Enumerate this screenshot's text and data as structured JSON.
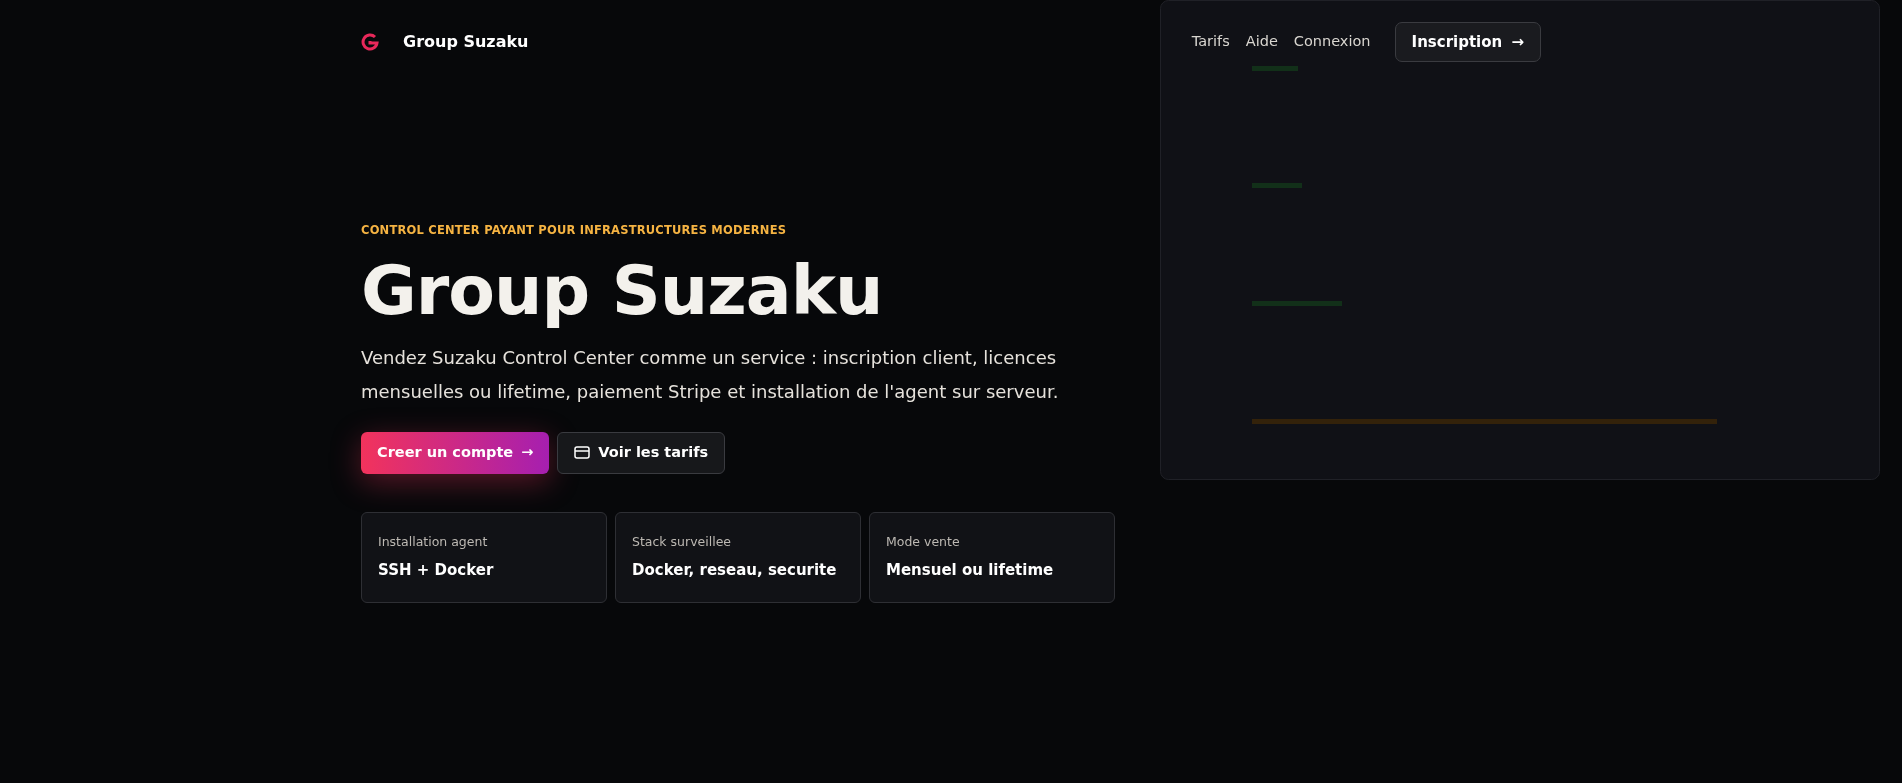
{
  "brand": {
    "name": "Group Suzaku"
  },
  "nav": {
    "links": [
      {
        "label": "Tarifs"
      },
      {
        "label": "Aide"
      },
      {
        "label": "Connexion"
      }
    ],
    "cta": {
      "label": "Inscription",
      "icon": "→"
    }
  },
  "hero": {
    "eyebrow": "CONTROL CENTER PAYANT POUR INFRASTRUCTURES MODERNES",
    "title": "Group Suzaku",
    "text": "Vendez Suzaku Control Center comme un service : inscription client, licences mensuelles ou lifetime, paiement Stripe et installation de l'agent sur serveur.",
    "buttons": [
      {
        "label": "Creer un compte",
        "kind": "primary",
        "icon": "→"
      },
      {
        "label": "Voir les tarifs",
        "kind": "secondary"
      }
    ],
    "features": [
      {
        "label": "Installation agent",
        "value": "SSH + Docker"
      },
      {
        "label": "Stack surveillee",
        "value": "Docker, reseau, securite"
      },
      {
        "label": "Mode vente",
        "value": "Mensuel ou lifetime"
      }
    ]
  }
}
